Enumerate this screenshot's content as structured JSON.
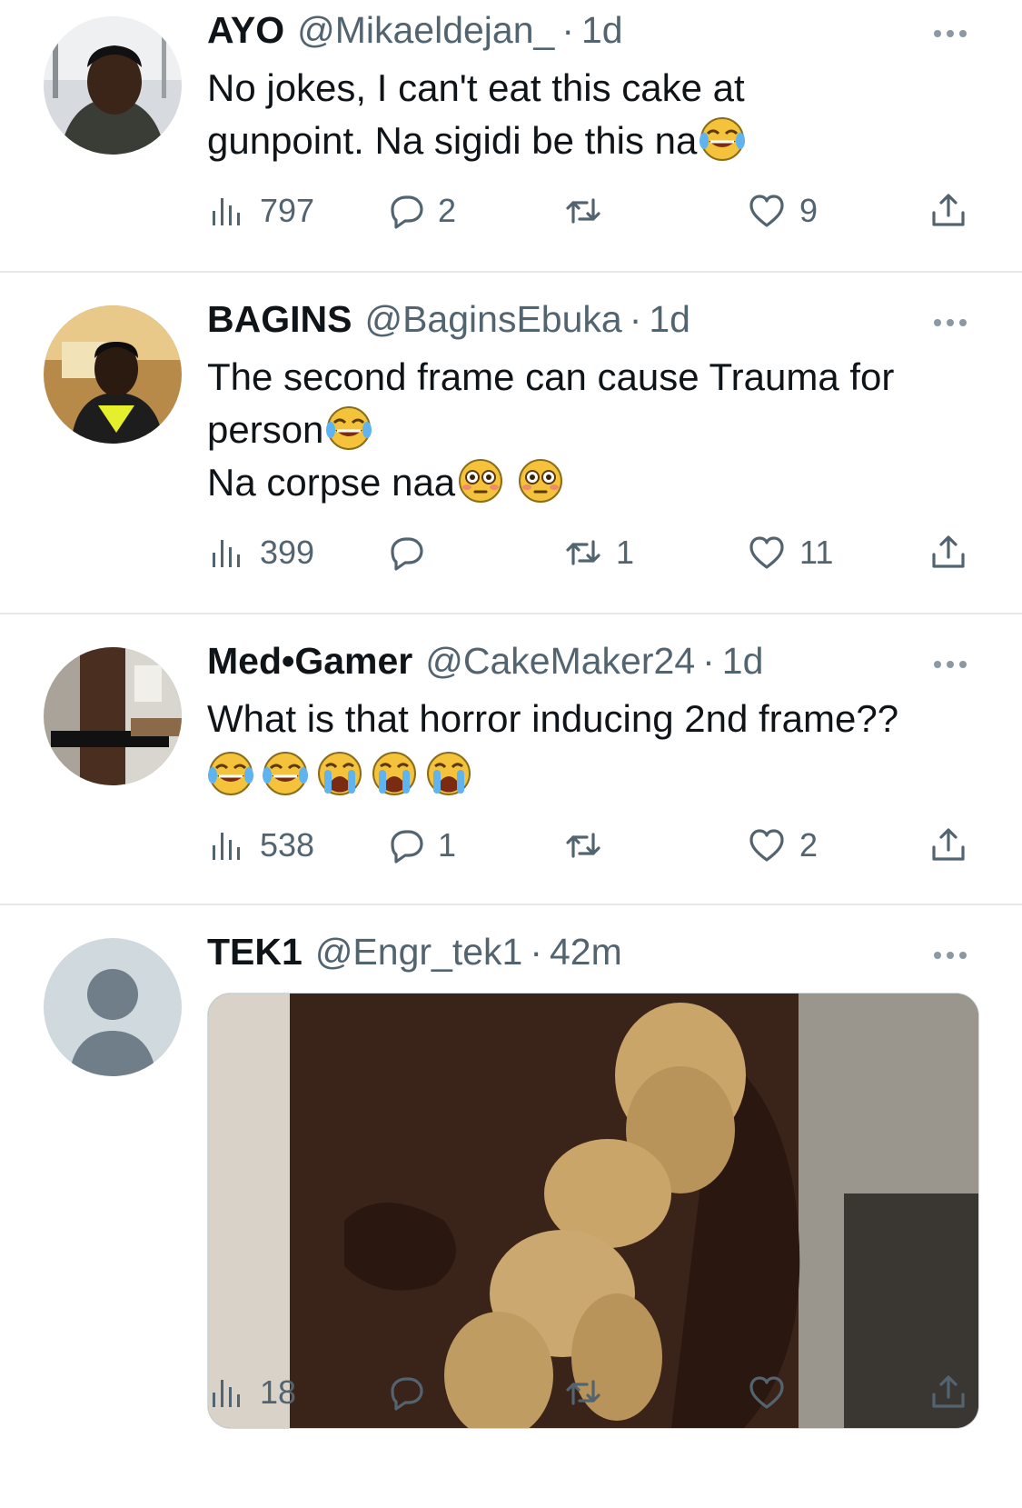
{
  "tweets": [
    {
      "name": "AYO",
      "handle": "@Mikaeldejan_",
      "dot": "·",
      "time": "1d",
      "lines": [
        "No jokes, I can't eat this cake at",
        "gunpoint. Na sigidi be this na"
      ],
      "emojis_line2": [
        "face-with-tears-of-joy"
      ],
      "views": "797",
      "replies": "2",
      "retweets": "",
      "likes": "9"
    },
    {
      "name": "BAGINS",
      "handle": "@BaginsEbuka",
      "dot": "·",
      "time": "1d",
      "lines": [
        "The second frame can cause Trauma for",
        "person",
        "Na corpse naa"
      ],
      "views": "399",
      "replies": "",
      "retweets": "1",
      "likes": "11"
    },
    {
      "name": "Med•Gamer",
      "handle": "@CakeMaker24",
      "dot": "·",
      "time": "1d",
      "lines": [
        "What is that horror inducing 2nd frame??"
      ],
      "views": "538",
      "replies": "1",
      "retweets": "",
      "likes": "2"
    },
    {
      "name": "TEK1",
      "handle": "@Engr_tek1",
      "dot": "·",
      "time": "42m",
      "views": "18",
      "replies": "",
      "retweets": "",
      "likes": ""
    }
  ],
  "icons": [
    "views-icon",
    "reply-icon",
    "retweet-icon",
    "like-icon",
    "share-icon",
    "more-icon"
  ],
  "colors": {
    "text": "#0f1419",
    "secondary": "#536471",
    "divider": "#e7e9ea",
    "default_avatar": "#cfd9de"
  }
}
